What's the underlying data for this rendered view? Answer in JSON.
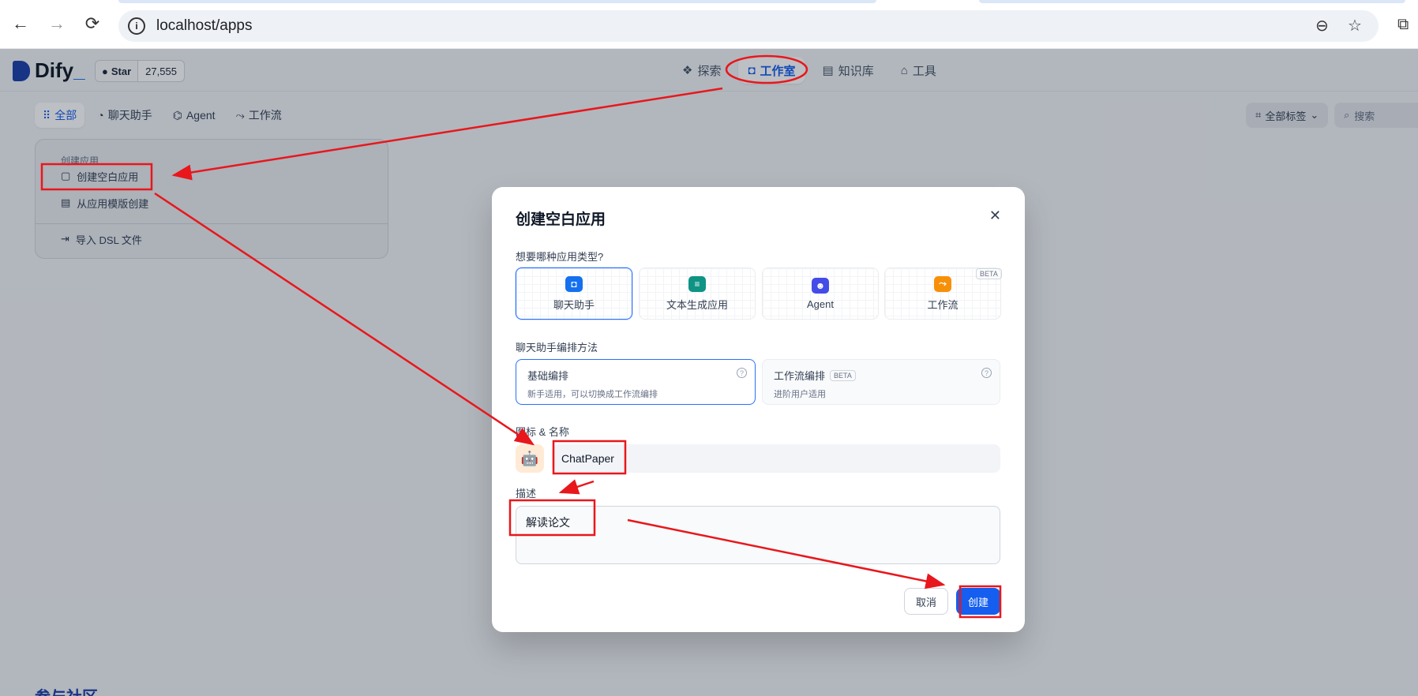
{
  "browser": {
    "url": "localhost/apps",
    "back_icon": "←",
    "forward_icon": "→",
    "reload_icon": "⟳",
    "zoom_icon": "⊖",
    "star_icon": "☆",
    "extension_icon": "⧉"
  },
  "header": {
    "logo_text": "Dify",
    "logo_suffix": "_",
    "github_star_label": "Star",
    "github_star_count": "27,555",
    "nav": [
      {
        "label": "探索",
        "icon": "❖"
      },
      {
        "label": "工作室",
        "icon": "◘"
      },
      {
        "label": "知识库",
        "icon": "▤"
      },
      {
        "label": "工具",
        "icon": "⌂"
      }
    ]
  },
  "filters": {
    "tabs": [
      {
        "label": "全部",
        "icon": "⠿"
      },
      {
        "label": "聊天助手",
        "icon": "◔"
      },
      {
        "label": "Agent",
        "icon": "⌬"
      },
      {
        "label": "工作流",
        "icon": "⤳"
      }
    ],
    "tag_filter": "全部标签",
    "search_placeholder": "搜索"
  },
  "create_card": {
    "title": "创建应用",
    "items": [
      "创建空白应用",
      "从应用模版创建",
      "导入 DSL 文件"
    ]
  },
  "community_heading": "参与社区",
  "modal": {
    "title": "创建空白应用",
    "close_icon": "✕",
    "type_question": "想要哪种应用类型?",
    "app_types": [
      {
        "label": "聊天助手",
        "color": "#1570ef"
      },
      {
        "label": "文本生成应用",
        "color": "#0e9384"
      },
      {
        "label": "Agent",
        "color": "#444ce7"
      },
      {
        "label": "工作流",
        "color": "#f79009"
      }
    ],
    "beta_tag": "BETA",
    "mode_label": "聊天助手编排方法",
    "modes": [
      {
        "title": "基础编排",
        "desc": "新手适用，可以切换成工作流编排"
      },
      {
        "title": "工作流编排",
        "desc": "进阶用户适用"
      }
    ],
    "help_icon": "?",
    "icon_name_label": "图标 & 名称",
    "app_icon": "🤖",
    "name_value": "ChatPaper",
    "desc_label": "描述",
    "desc_value": "解读论文",
    "cancel_label": "取消",
    "create_label": "创建"
  },
  "annotation_color": "#e8171c"
}
